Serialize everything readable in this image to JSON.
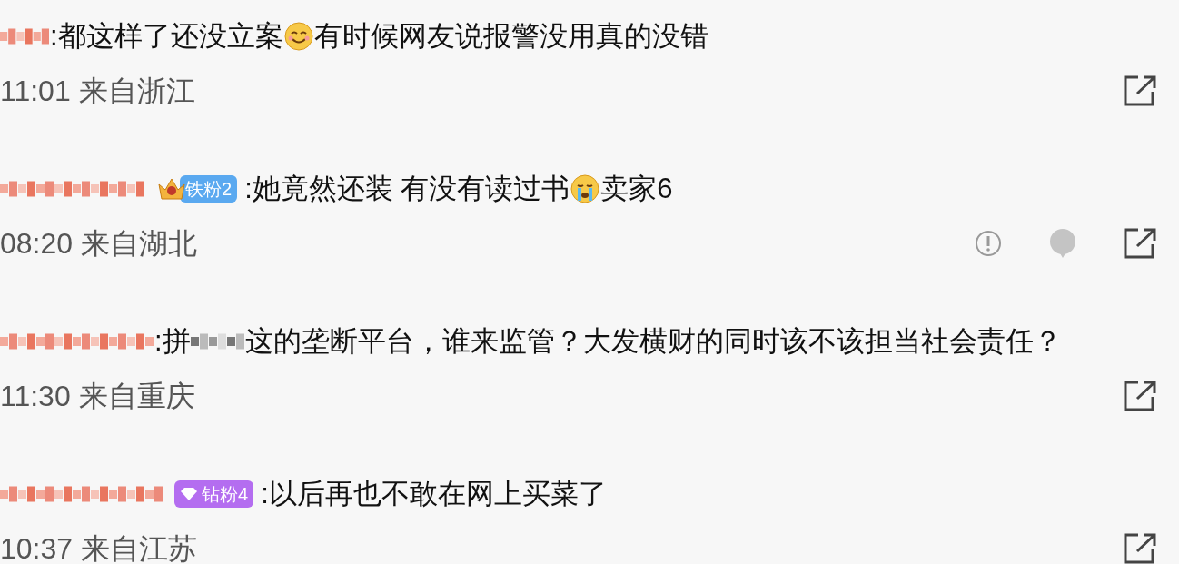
{
  "comments": [
    {
      "segments": [
        {
          "kind": "text",
          "text": ":都这样了还没立案"
        },
        {
          "kind": "smile-emoji"
        },
        {
          "kind": "text",
          "text": "有时候网友说报警没用真的没错"
        }
      ],
      "time": "11:01 来自浙江",
      "actions": [
        {
          "kind": "share"
        }
      ]
    },
    {
      "badge": {
        "kind": "iron",
        "text": "铁粉2"
      },
      "segments": [
        {
          "kind": "text",
          "text": ":她竟然还装 有没有读过书"
        },
        {
          "kind": "cry-emoji"
        },
        {
          "kind": "text",
          "text": "卖家6"
        }
      ],
      "time": "08:20 来自湖北",
      "actions": [
        {
          "kind": "report"
        },
        {
          "kind": "comment"
        },
        {
          "kind": "share"
        }
      ]
    },
    {
      "segments": [
        {
          "kind": "text",
          "text": ":拼"
        },
        {
          "kind": "blur"
        },
        {
          "kind": "text",
          "text": "这的垄断平台，谁来监管？大发横财的同时该不该担当社会责任？"
        }
      ],
      "time": "11:30 来自重庆",
      "actions": [
        {
          "kind": "share"
        }
      ]
    },
    {
      "badge": {
        "kind": "diamond",
        "text": "钻粉4"
      },
      "segments": [
        {
          "kind": "text",
          "text": ":以后再也不敢在网上买菜了"
        }
      ],
      "time": "10:37 来自江苏",
      "actions": [
        {
          "kind": "share"
        }
      ]
    }
  ]
}
